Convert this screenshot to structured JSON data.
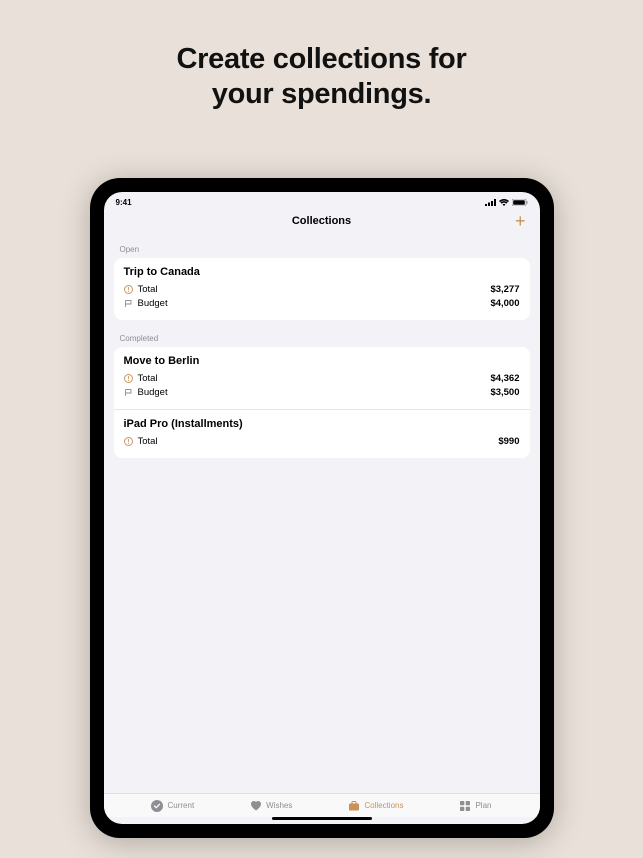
{
  "marketing": {
    "line1": "Create collections for",
    "line2": "your spendings."
  },
  "status": {
    "time": "9:41"
  },
  "nav": {
    "title": "Collections",
    "add_label": "+"
  },
  "sections": {
    "open": {
      "header": "Open",
      "items": [
        {
          "title": "Trip to Canada",
          "rows": [
            {
              "icon": "total",
              "label": "Total",
              "value": "$3,277"
            },
            {
              "icon": "budget",
              "label": "Budget",
              "value": "$4,000"
            }
          ]
        }
      ]
    },
    "completed": {
      "header": "Completed",
      "items": [
        {
          "title": "Move to Berlin",
          "rows": [
            {
              "icon": "total",
              "label": "Total",
              "value": "$4,362"
            },
            {
              "icon": "budget",
              "label": "Budget",
              "value": "$3,500"
            }
          ]
        },
        {
          "title": "iPad Pro (Installments)",
          "rows": [
            {
              "icon": "total",
              "label": "Total",
              "value": "$990"
            }
          ]
        }
      ]
    }
  },
  "tabs": [
    {
      "id": "current",
      "label": "Current",
      "active": false
    },
    {
      "id": "wishes",
      "label": "Wishes",
      "active": false
    },
    {
      "id": "collections",
      "label": "Collections",
      "active": true
    },
    {
      "id": "plan",
      "label": "Plan",
      "active": false
    }
  ],
  "colors": {
    "accent": "#c89258",
    "background": "#e9e1d9",
    "screen_bg": "#f2f2f7",
    "text_secondary": "#8e8e93"
  }
}
